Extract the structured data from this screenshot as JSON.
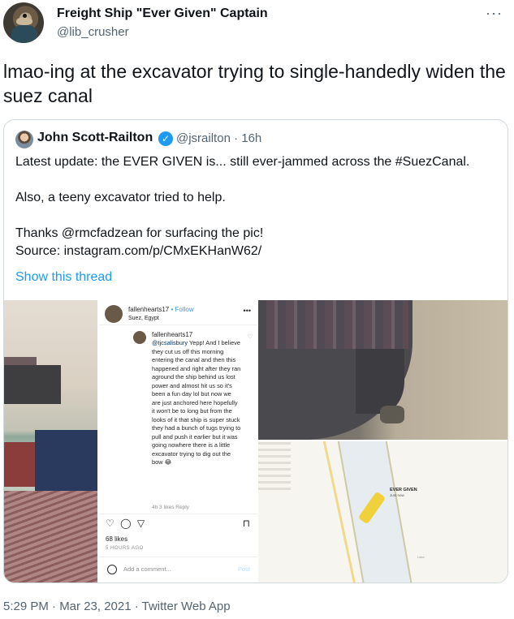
{
  "tweet": {
    "display_name": "Freight Ship \"Ever Given\" Captain",
    "handle": "@lib_crusher",
    "more_icon": "more-horizontal-icon",
    "text": "lmao-ing at the excavator trying to single-handedly widen the suez canal",
    "timestamp": "5:29 PM · Mar 23, 2021 · Twitter Web App"
  },
  "quote": {
    "display_name": "John Scott-Railton",
    "handle_time": "@jsrailton · 16h",
    "verified_icon": "verified-badge-icon",
    "lines": [
      "Latest update: the EVER GIVEN is...  still ever-jammed across the #SuezCanal.",
      "",
      "Also, a teeny excavator tried to help.",
      "",
      "Thanks @rmcfadzean for surfacing the pic!",
      "Source: instagram.com/p/CMxEKHanW62/"
    ],
    "show_thread": "Show this thread"
  },
  "instagram": {
    "username": "fallenhearts17",
    "follow": "• Follow",
    "location": "Suez, Egypt",
    "more": "•••",
    "comment_user": "fallenhearts17",
    "comment_mention": "@tjcsalisbury",
    "comment_text": " Yepp! And I believe they cut us off this morning entering the canal and then this happened and right after they ran aground the ship behind us lost power and almost hit us so it's been a fun day lol but now we are just anchored here hopefully it won't be to long but from the looks of it that ship is super stuck they had a bunch of tugs trying to pull and push it earlier but it was going nowhere there is a little excavator trying to dig out the bow 😂",
    "comment_meta": "4h   3 likes   Reply",
    "likes": "68 likes",
    "time_ago": "5 HOURS AGO",
    "add_comment": "Add a comment...",
    "post": "Post"
  },
  "map": {
    "ship_label": "EVER GIVEN",
    "ship_sub": "Just now",
    "lake": "Lake"
  }
}
